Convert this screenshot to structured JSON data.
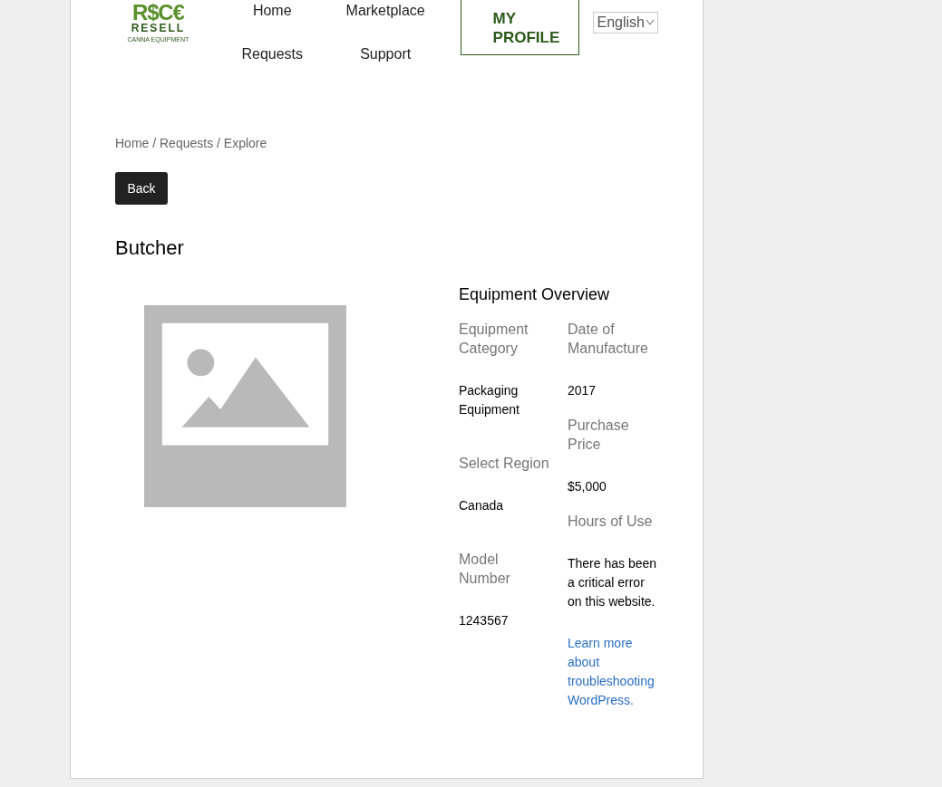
{
  "logo": {
    "mark": "R$C€",
    "name": "RESELL",
    "tagline": "CANNA EQUIPMENT"
  },
  "nav": [
    {
      "label": "Home"
    },
    {
      "label": "Marketplace"
    },
    {
      "label": "Requests"
    },
    {
      "label": "Support"
    }
  ],
  "profile_button": "MY PROFILE",
  "language_select": {
    "value": "English"
  },
  "breadcrumb": "Home / Requests / Explore",
  "back_button": "Back",
  "title": "Butcher",
  "overview": {
    "heading": "Equipment Overview",
    "columns": [
      [
        {
          "label": "Equipment Category",
          "value": "Packaging Equipment"
        },
        {
          "label": "Select Region",
          "value": "Canada"
        },
        {
          "label": "Model Number",
          "value": "1243567"
        }
      ],
      [
        {
          "label": "Date of Manufacture",
          "value": "2017"
        },
        {
          "label": "Purchase Price",
          "value": "$5,000"
        },
        {
          "label": "Hours of Use",
          "value": "There has been a critical error on this website.",
          "link": "Learn more about troubleshooting WordPress."
        }
      ]
    ]
  }
}
